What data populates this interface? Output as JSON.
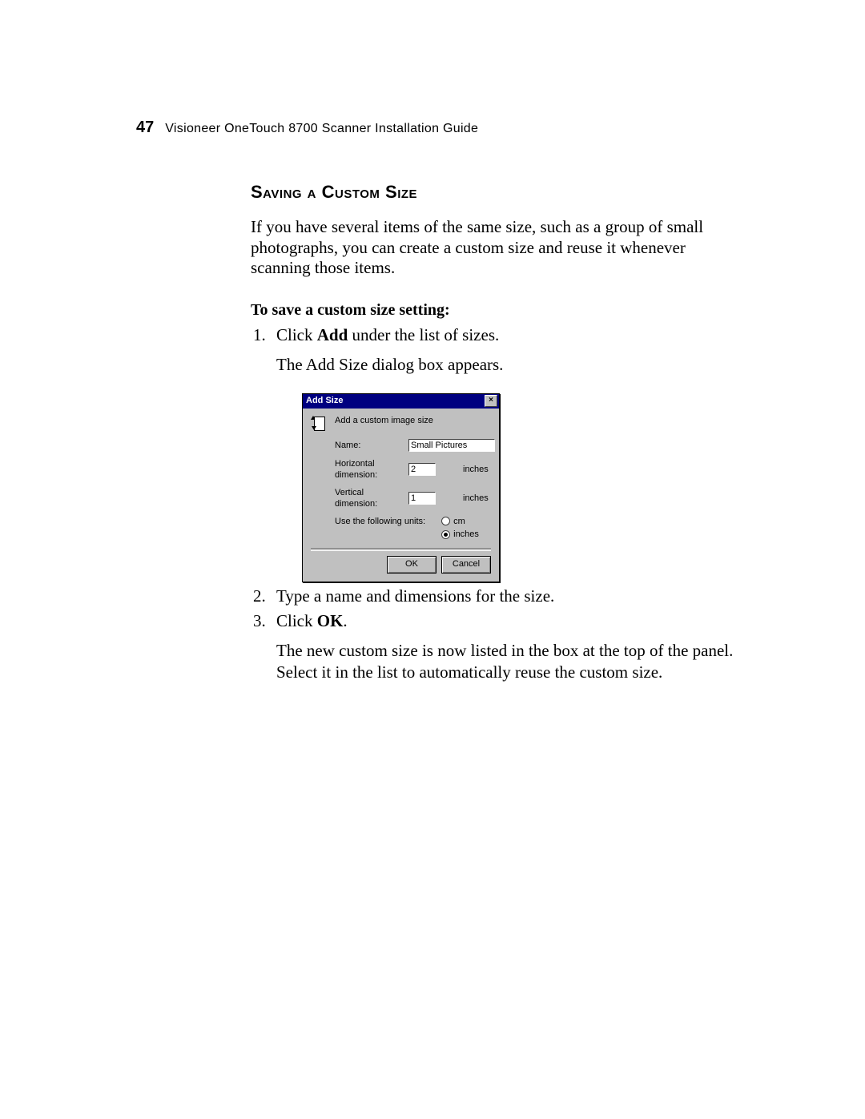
{
  "header": {
    "page_number": "47",
    "running_title": "Visioneer OneTouch 8700 Scanner Installation Guide"
  },
  "section": {
    "heading": "Saving a Custom Size",
    "intro": "If you have several items of the same size, such as a group of small photographs, you can create a custom size and reuse it whenever scanning those items.",
    "procedure_heading": "To save a custom size setting:"
  },
  "steps": {
    "s1_prefix": "Click ",
    "s1_bold": "Add",
    "s1_suffix": " under the list of sizes.",
    "s1_cont": "The Add Size dialog box appears.",
    "s2": "Type a name and dimensions for the size.",
    "s3_prefix": "Click ",
    "s3_bold": "OK",
    "s3_suffix": ".",
    "s3_cont": "The new custom size is now listed in the box at the top of the panel. Select it in the list to automatically reuse the custom size."
  },
  "dialog": {
    "title": "Add Size",
    "close_glyph": "×",
    "caption": "Add a custom image size",
    "name_label": "Name:",
    "name_value": "Small Pictures",
    "hdim_label": "Horizontal dimension:",
    "hdim_value": "2",
    "vdim_label": "Vertical dimension:",
    "vdim_value": "1",
    "unit_suffix": "inches",
    "units_label": "Use the following units:",
    "radio_cm": "cm",
    "radio_inches": "inches",
    "ok_label": "OK",
    "cancel_label": "Cancel"
  }
}
